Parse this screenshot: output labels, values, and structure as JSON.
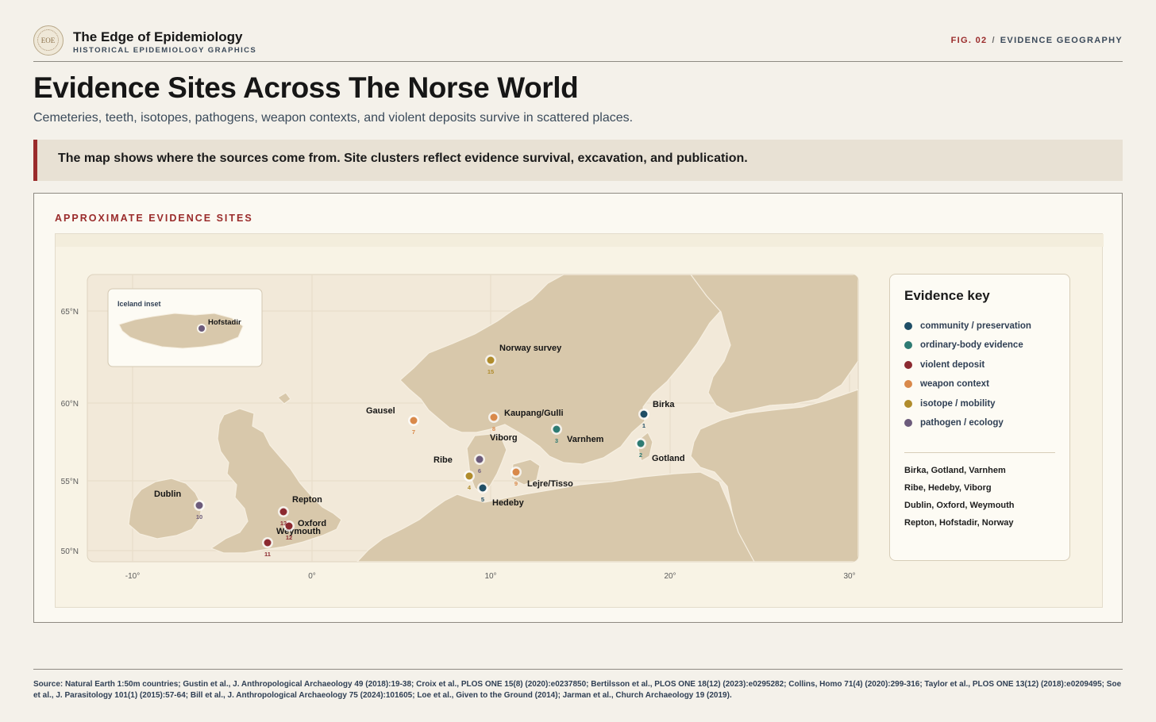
{
  "brand": {
    "logo_text": "EOE",
    "title": "The Edge of Epidemiology",
    "subtitle": "HISTORICAL EPIDEMIOLOGY GRAPHICS"
  },
  "figure_tag": {
    "number": "FIG. 02",
    "separator": "/",
    "label": "EVIDENCE GEOGRAPHY"
  },
  "page": {
    "title": "Evidence Sites Across The Norse World",
    "subtitle": "Cemeteries, teeth, isotopes, pathogens, weapon contexts, and violent deposits survive in scattered places.",
    "callout": "The map shows where the sources come from. Site clusters reflect evidence survival, excavation, and publication."
  },
  "panel": {
    "heading": "APPROXIMATE EVIDENCE SITES"
  },
  "map": {
    "inset_label": "Iceland inset",
    "lat_ticks": [
      "65°N",
      "60°N",
      "55°N",
      "50°N"
    ],
    "lon_ticks": [
      "-10°",
      "0°",
      "10°",
      "20°",
      "30°"
    ],
    "categories": {
      "community": {
        "label": "community / preservation",
        "color": "#1f4e66"
      },
      "ordinary": {
        "label": "ordinary-body evidence",
        "color": "#2e7b73"
      },
      "violent": {
        "label": "violent deposit",
        "color": "#8c2a30"
      },
      "weapon": {
        "label": "weapon context",
        "color": "#d9894a"
      },
      "isotope": {
        "label": "isotope / mobility",
        "color": "#b08c2c"
      },
      "pathogen": {
        "label": "pathogen / ecology",
        "color": "#6c5b7b"
      }
    },
    "sites": [
      {
        "num": "1",
        "name": "Birka",
        "category": "community",
        "lon": 17.5,
        "lat": 59.3
      },
      {
        "num": "2",
        "name": "Gotland",
        "category": "ordinary",
        "lon": 18.5,
        "lat": 57.5
      },
      {
        "num": "3",
        "name": "Varnhem",
        "category": "ordinary",
        "lon": 13.6,
        "lat": 58.4
      },
      {
        "num": "4",
        "name": "",
        "category": "isotope",
        "lon": 9.0,
        "lat": 55.3
      },
      {
        "num": "5",
        "name": "Hedeby",
        "category": "community",
        "lon": 9.6,
        "lat": 54.5
      },
      {
        "num": "6",
        "name": "Ribe",
        "category": "pathogen",
        "lon": 9.4,
        "lat": 56.3
      },
      {
        "num": "7",
        "name": "Gausel",
        "category": "weapon",
        "lon": 5.6,
        "lat": 58.9
      },
      {
        "num": "8",
        "name": "Kaupang/Gulli",
        "category": "weapon",
        "lon": 10.1,
        "lat": 59.1
      },
      {
        "num": "9",
        "name": "Lejre/Tisso",
        "category": "weapon",
        "lon": 11.5,
        "lat": 55.6
      },
      {
        "num": "10",
        "name": "Dublin",
        "category": "pathogen",
        "lon": -6.3,
        "lat": 53.3
      },
      {
        "num": "11",
        "name": "Weymouth",
        "category": "violent",
        "lon": -2.4,
        "lat": 50.6
      },
      {
        "num": "12",
        "name": "Oxford",
        "category": "violent",
        "lon": -1.3,
        "lat": 51.8
      },
      {
        "num": "13",
        "name": "Repton",
        "category": "violent",
        "lon": -1.6,
        "lat": 52.8
      },
      {
        "num": "15",
        "name": "Norway survey",
        "category": "isotope",
        "lon": 10.0,
        "lat": 61.9
      },
      {
        "num": "",
        "name": "Viborg",
        "category": "",
        "lon": 9.4,
        "lat": 56.5
      },
      {
        "num": "",
        "name": "Hofstadir",
        "category": "pathogen",
        "lon": -17.0,
        "lat": 65.6
      }
    ]
  },
  "legend": {
    "title": "Evidence key",
    "groups": [
      "Birka, Gotland, Varnhem",
      "Ribe, Hedeby, Viborg",
      "Dublin, Oxford, Weymouth",
      "Repton, Hofstadir, Norway"
    ]
  },
  "footer": {
    "source": "Source: Natural Earth 1:50m countries; Gustin et al., J. Anthropological Archaeology 49 (2018):19-38; Croix et al., PLOS ONE 15(8) (2020):e0237850; Bertilsson et al., PLOS ONE 18(12) (2023):e0295282; Collins, Homo 71(4) (2020):299-316; Taylor et al., PLOS ONE 13(12) (2018):e0209495; Soe et al., J. Parasitology 101(1) (2015):57-64; Bill et al., J. Anthropological Archaeology 75 (2024):101605; Loe et al., Given to the Ground (2014); Jarman et al., Church Archaeology 19 (2019)."
  }
}
